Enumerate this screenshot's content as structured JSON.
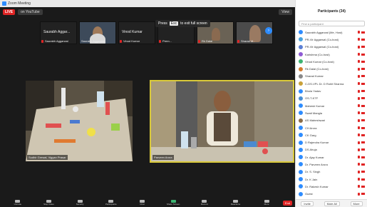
{
  "window": {
    "title": "Zoom Meeting"
  },
  "topbar": {
    "live_label": "LIVE",
    "youtube_label": "on YouTube",
    "view_label": "View"
  },
  "thumbnails": [
    {
      "label": "Saurabh Aggar...",
      "name": "Saurabh Aggarwal",
      "type": "text"
    },
    {
      "label": "",
      "name": "Saurabh Aggarwal",
      "type": "video"
    },
    {
      "label": "Vinod Kumar",
      "name": "Vinod Kumar",
      "type": "text"
    },
    {
      "label": "",
      "name": "Prem...",
      "type": "text"
    },
    {
      "label": "",
      "name": "Rk Dalal",
      "type": "video"
    },
    {
      "label": "",
      "name": "Sharad M..",
      "type": "video"
    }
  ],
  "tooltip": {
    "pre": "Press",
    "key": "Esc",
    "post": "to exit full screen"
  },
  "main_videos": {
    "left_name": "Sudhir Grewal, Vigyan Prasar",
    "right_name": "Parveen Arora"
  },
  "toolbar": [
    {
      "label": "Unmute"
    },
    {
      "label": "Stop Video"
    },
    {
      "label": "Security"
    },
    {
      "label": "Participants"
    },
    {
      "label": "Chat"
    },
    {
      "label": "Share Screen"
    },
    {
      "label": "Record"
    },
    {
      "label": "Reactions"
    },
    {
      "label": "More"
    }
  ],
  "toolbar_end": "End",
  "panel": {
    "title": "Participants (34)",
    "search_placeholder": "Find a participant",
    "participants": [
      {
        "name": "Saurabh Aggarwal (Me, Host)",
        "color": "#2d8cff"
      },
      {
        "name": "PR-Vir Aggarwal (Co-host)",
        "color": "#4aa3df"
      },
      {
        "name": "PR-Vir Aggarwal (Co-host)",
        "color": "#5b7fd4"
      },
      {
        "name": "Karishma (Co-host)",
        "color": "#8e5bd4"
      },
      {
        "name": "Vinod Kumar (Co-host)",
        "color": "#3cb371"
      },
      {
        "name": "Rk Dalal (Co-host)",
        "color": "#d47b2d"
      },
      {
        "name": "Sharad Kumar",
        "color": "#888888"
      },
      {
        "name": "C-DS-VPL Dr. D Rohit Sharma",
        "color": "#c9a13a"
      },
      {
        "name": "Bhola Yadav",
        "color": "#2d8cff"
      },
      {
        "name": "OS-T-KTF",
        "color": "#4a8fd4"
      },
      {
        "name": "Mahesh Kumar",
        "color": "#2d8cff"
      },
      {
        "name": "Swati Mangla",
        "color": "#2d8cff"
      },
      {
        "name": "AS Maheshwari",
        "color": "#8a6d4a"
      },
      {
        "name": "CH Arora",
        "color": "#2d8cff"
      },
      {
        "name": "CK Garg",
        "color": "#2d8cff"
      },
      {
        "name": "D Rajendra Kumar",
        "color": "#2d8cff"
      },
      {
        "name": "DS Ahuja",
        "color": "#2d8cff"
      },
      {
        "name": "Dr. Ajay Kumar",
        "color": "#2d8cff"
      },
      {
        "name": "Dr. Parveen Arora",
        "color": "#2d8cff"
      },
      {
        "name": "Dr. S. Singh",
        "color": "#2d8cff"
      },
      {
        "name": "Dr. K Jain",
        "color": "#2d8cff"
      },
      {
        "name": "Dr. Rakesh Kumar",
        "color": "#2d8cff"
      },
      {
        "name": "Guest",
        "color": "#2d8cff"
      }
    ],
    "footer": {
      "invite": "Invite",
      "mute_all": "Mute All",
      "more": "More"
    }
  }
}
